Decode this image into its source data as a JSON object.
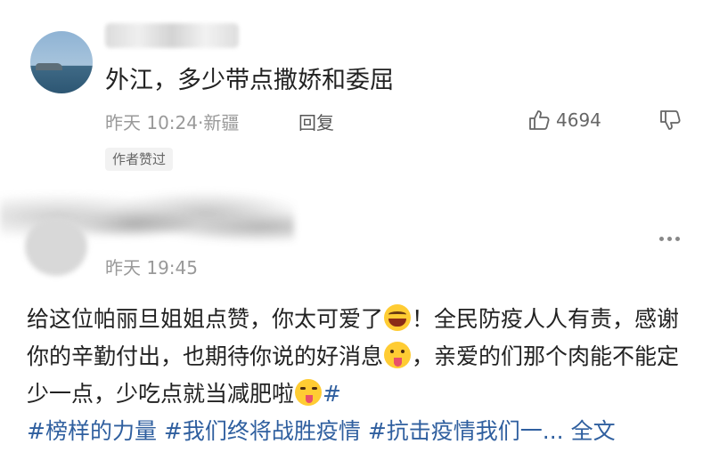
{
  "comment1": {
    "username": "",
    "text": "外江，多少带点撒娇和委屈",
    "time": "昨天 10:24",
    "location": "新疆",
    "separator": "·",
    "reply_label": "回复",
    "like_count": "4694",
    "author_badge": "作者赞过"
  },
  "comment2": {
    "time": "昨天 19:45",
    "segments": {
      "s1": "给这位帕丽旦姐姐点赞，你太可爱了",
      "s2": "！全民防疫人人有责，感谢你的辛勤付出，也期待你说的好消息",
      "s3": "，亲爱的们那个肉能不能定少一点，少吃点就当减肥啦",
      "tag1": "#榜样的力量",
      "tag2": "#我们终将战胜疫情",
      "tag3": "#抗击疫情我们一...",
      "expand": "全文",
      "hash_start": "#"
    }
  },
  "icons": {
    "emoji1": "face-with-tears-of-joy",
    "emoji2": "face-with-tongue",
    "emoji3": "winking-face-with-tongue"
  },
  "colors": {
    "link": "#2f5f9f",
    "meta": "#999999"
  }
}
